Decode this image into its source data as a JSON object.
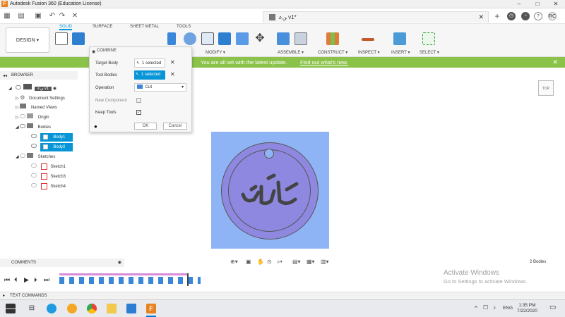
{
  "app": {
    "title": "Autodesk Fusion 360 (Education License)",
    "logo": "F"
  },
  "tab": {
    "name": "ﻦﻋ v1*"
  },
  "user": {
    "initials": "RC"
  },
  "workspace": {
    "label": "DESIGN ▾"
  },
  "ribbon_tabs": [
    "SOLID",
    "SURFACE",
    "SHEET METAL",
    "TOOLS"
  ],
  "ribbon_groups": [
    "MODIFY ▾",
    "ASSEMBLE ▾",
    "CONSTRUCT ▾",
    "INSPECT ▾",
    "INSERT ▾",
    "SELECT ▾"
  ],
  "banner": {
    "message": "You are all set with the latest update.",
    "link": "Find out what's new."
  },
  "browser": {
    "header": "BROWSER",
    "root": "ﻦﻋ v1",
    "items": [
      "Document Settings",
      "Named Views",
      "Origin",
      "Bodies",
      "Body1",
      "Body2",
      "Sketches",
      "Sketch1",
      "Sketch3",
      "Sketch4"
    ]
  },
  "dialog": {
    "title": "COMBINE",
    "target_label": "Target Body",
    "target_value": "1 selected",
    "tool_label": "Tool Bodies",
    "tool_value": "1 selected",
    "operation_label": "Operation",
    "operation_value": "Cut",
    "new_component_label": "New Component",
    "keep_tools_label": "Keep Tools",
    "ok": "OK",
    "cancel": "Cancel"
  },
  "comments": {
    "label": "COMMENTS"
  },
  "status": {
    "bodies": "2 Bodies"
  },
  "activate": {
    "line1": "Activate Windows",
    "line2": "Go to Settings to activate Windows."
  },
  "text_commands": {
    "label": "TEXT COMMANDS"
  },
  "taskbar": {
    "lang": "ENG",
    "time": "1:35 PM",
    "date": "7/22/2020"
  },
  "colors": {
    "accent": "#0696d7",
    "banner": "#8bc34a",
    "canvas": "#8fb4f5",
    "coin": "#8e88e0"
  }
}
